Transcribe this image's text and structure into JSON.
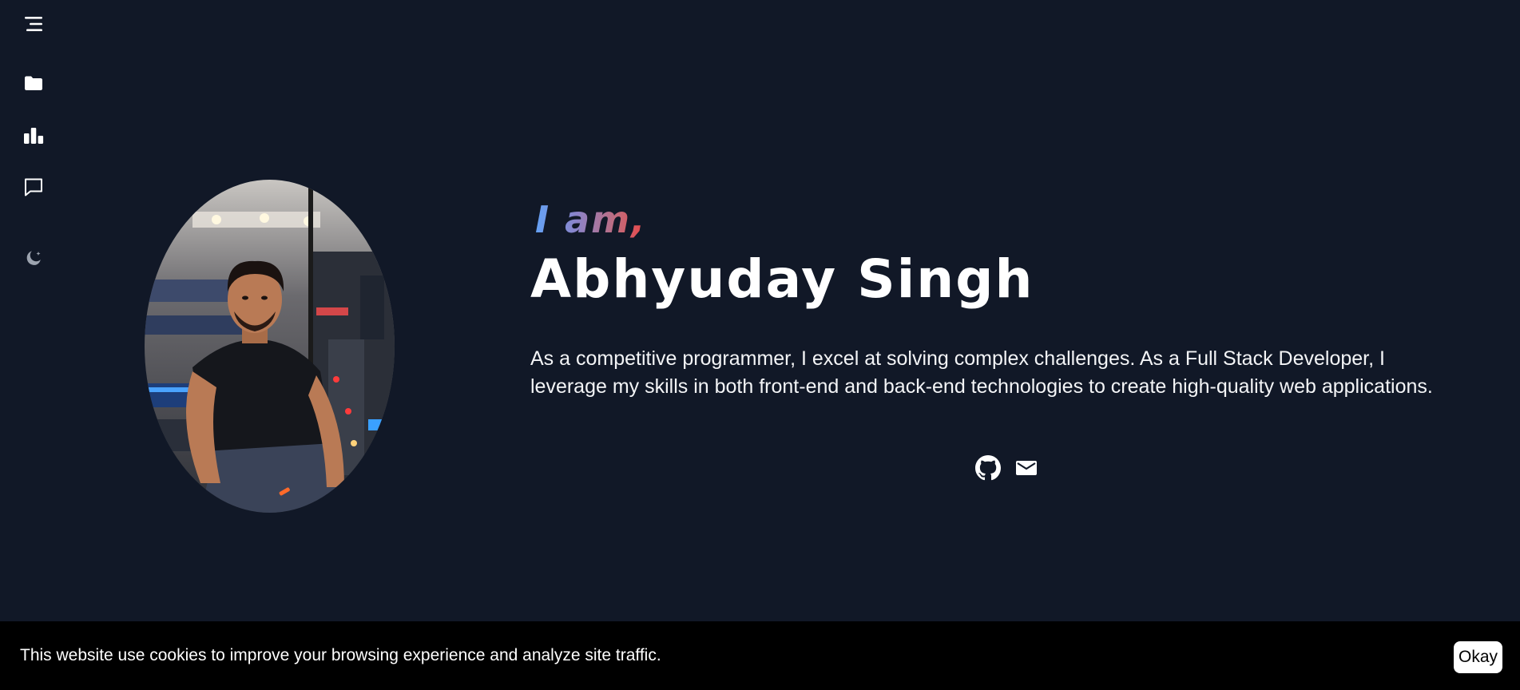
{
  "sidebar": {
    "items": [
      {
        "icon": "menu-icon"
      },
      {
        "icon": "folder-icon"
      },
      {
        "icon": "bar-chart-icon"
      },
      {
        "icon": "message-icon"
      },
      {
        "icon": "moon-icon"
      }
    ]
  },
  "profile": {
    "greeting": "I am,",
    "name": "Abhyuday Singh",
    "bio": "As a competitive programmer, I excel at solving complex challenges. As a Full Stack Developer, I leverage my skills in both front-end and back-end technologies to create high-quality web applications.",
    "photo_alt": "Abhyuday Singh",
    "socials": [
      {
        "icon": "github-icon"
      },
      {
        "icon": "mail-icon"
      }
    ]
  },
  "cookie_banner": {
    "message": "This website use cookies to improve your browsing experience and analyze site traffic.",
    "button_label": "Okay"
  },
  "colors": {
    "background": "#111827",
    "banner": "#000000",
    "greeting_gradient": [
      "#60a5fa",
      "#8b83c9",
      "#c26a7a",
      "#ef4444"
    ]
  }
}
